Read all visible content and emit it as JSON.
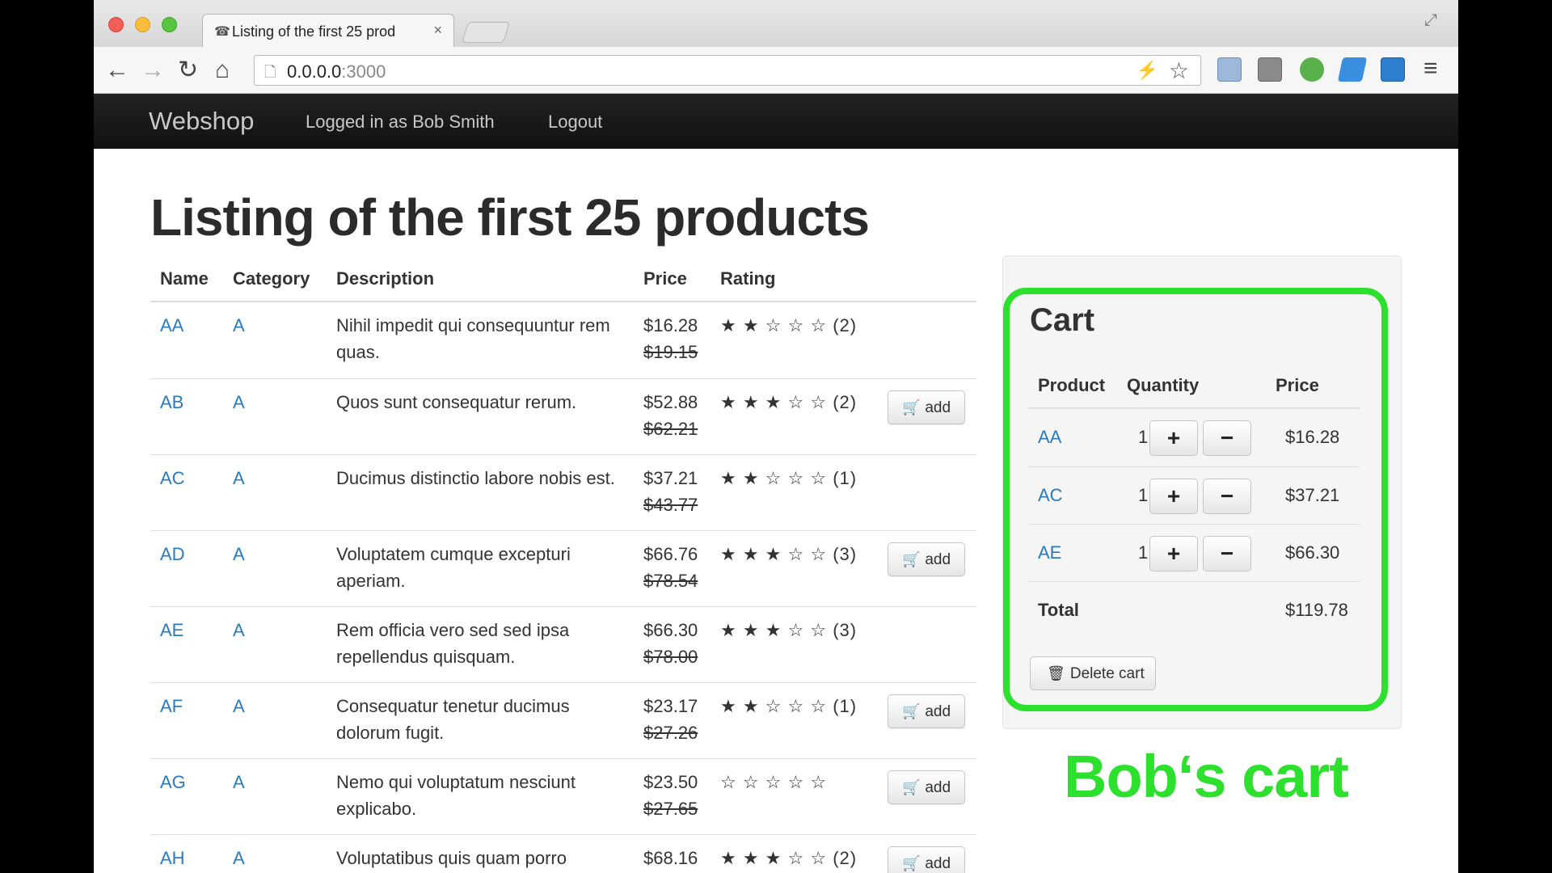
{
  "browser": {
    "tab_title": "Listing of the first 25 prod",
    "tab_close": "×",
    "url_host": "0.0.0.0",
    "url_port": ":3000"
  },
  "icons": {
    "tab_favicon": "☎",
    "back": "←",
    "forward": "→",
    "reload": "↻",
    "home": "⌂",
    "page": "🗋",
    "bolt": "⚡",
    "star": "☆",
    "menu": "≡",
    "fullscreen": "⤢",
    "cart": "🛒",
    "trash": "🗑"
  },
  "navbar": {
    "brand": "Webshop",
    "logged_in": "Logged in as Bob Smith",
    "logout": "Logout"
  },
  "page_title": "Listing of the first 25 products",
  "products_table": {
    "headers": [
      "Name",
      "Category",
      "Description",
      "Price",
      "Rating"
    ],
    "add_label": "add",
    "rows": [
      {
        "name": "AA",
        "category": "A",
        "description": "Nihil impedit qui consequuntur rem quas.",
        "price": "$16.28",
        "old_price": "$19.15",
        "stars": "★ ★ ☆ ☆ ☆",
        "count": "(2)",
        "show_add": false
      },
      {
        "name": "AB",
        "category": "A",
        "description": "Quos sunt consequatur rerum.",
        "price": "$52.88",
        "old_price": "$62.21",
        "stars": "★ ★ ★ ☆ ☆",
        "count": "(2)",
        "show_add": true
      },
      {
        "name": "AC",
        "category": "A",
        "description": "Ducimus distinctio labore nobis est.",
        "price": "$37.21",
        "old_price": "$43.77",
        "stars": "★ ★ ☆ ☆ ☆",
        "count": "(1)",
        "show_add": false
      },
      {
        "name": "AD",
        "category": "A",
        "description": "Voluptatem cumque excepturi aperiam.",
        "price": "$66.76",
        "old_price": "$78.54",
        "stars": "★ ★ ★ ☆ ☆",
        "count": "(3)",
        "show_add": true
      },
      {
        "name": "AE",
        "category": "A",
        "description": "Rem officia vero sed sed ipsa repellendus quisquam.",
        "price": "$66.30",
        "old_price": "$78.00",
        "stars": "★ ★ ★ ☆ ☆",
        "count": "(3)",
        "show_add": false
      },
      {
        "name": "AF",
        "category": "A",
        "description": "Consequatur tenetur ducimus dolorum fugit.",
        "price": "$23.17",
        "old_price": "$27.26",
        "stars": "★ ★ ☆ ☆ ☆",
        "count": "(1)",
        "show_add": true
      },
      {
        "name": "AG",
        "category": "A",
        "description": "Nemo qui voluptatum nesciunt explicabo.",
        "price": "$23.50",
        "old_price": "$27.65",
        "stars": "☆ ☆ ☆ ☆ ☆",
        "count": "",
        "show_add": true
      },
      {
        "name": "AH",
        "category": "A",
        "description": "Voluptatibus quis quam porro",
        "price": "$68.16",
        "old_price": "",
        "stars": "★ ★ ★ ☆ ☆",
        "count": "(2)",
        "show_add": true
      }
    ]
  },
  "cart": {
    "title": "Cart",
    "headers": [
      "Product",
      "Quantity",
      "Price"
    ],
    "plus": "+",
    "minus": "−",
    "items": [
      {
        "product": "AA",
        "quantity": "1",
        "price": "$16.28"
      },
      {
        "product": "AC",
        "quantity": "1",
        "price": "$37.21"
      },
      {
        "product": "AE",
        "quantity": "1",
        "price": "$66.30"
      }
    ],
    "total_label": "Total",
    "total_value": "$119.78",
    "delete_label": "Delete cart",
    "highlight_color": "#2ee02e"
  },
  "annotation": "Bob‘s cart"
}
